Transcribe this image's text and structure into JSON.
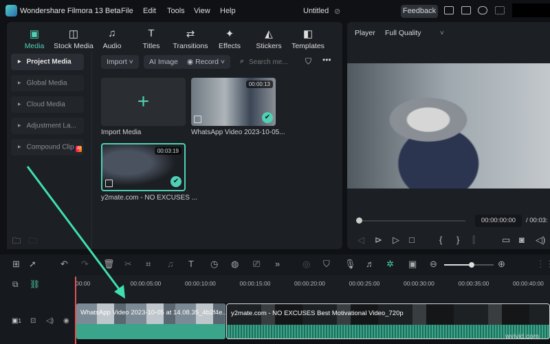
{
  "app": {
    "title": "Wondershare Filmora 13 Beta",
    "project": "Untitled",
    "menu": [
      "File",
      "Edit",
      "Tools",
      "View",
      "Help"
    ],
    "feedback": "Feedback"
  },
  "tabs": [
    {
      "label": "Media",
      "icon": "media-icon",
      "glyph": "▣"
    },
    {
      "label": "Stock Media",
      "icon": "stock-media-icon",
      "glyph": "◫"
    },
    {
      "label": "Audio",
      "icon": "music-note-icon",
      "glyph": "♫"
    },
    {
      "label": "Titles",
      "icon": "text-icon",
      "glyph": "T"
    },
    {
      "label": "Transitions",
      "icon": "transitions-icon",
      "glyph": "⇄"
    },
    {
      "label": "Effects",
      "icon": "effects-icon",
      "glyph": "✦"
    },
    {
      "label": "Stickers",
      "icon": "stickers-icon",
      "glyph": "◭"
    },
    {
      "label": "Templates",
      "icon": "templates-icon",
      "glyph": "◧"
    }
  ],
  "sidebar": {
    "items": [
      {
        "label": "Project Media"
      },
      {
        "label": "Global Media"
      },
      {
        "label": "Cloud Media"
      },
      {
        "label": "Adjustment La..."
      },
      {
        "label": "Compound Clip",
        "badge": "AI"
      }
    ]
  },
  "toolbar": {
    "import": "Import",
    "ai_image": "AI Image",
    "record": "Record",
    "search_placeholder": "Search me..."
  },
  "media": [
    {
      "label": "Import Media"
    },
    {
      "label": "WhatsApp Video 2023-10-05...",
      "duration": "00:00:13"
    },
    {
      "label": "y2mate.com - NO EXCUSES ...",
      "duration": "00:03:19"
    }
  ],
  "player": {
    "label": "Player",
    "quality": "Full Quality",
    "current": "00:00:00:00",
    "total": "/ 00:03:"
  },
  "timeline": {
    "ruler": [
      "00:00",
      "00:00:05:00",
      "00:00:10:00",
      "00:00:15:00",
      "00:00:20:00",
      "00:00:25:00",
      "00:00:30:00",
      "00:00:35:00",
      "00:00:40:00"
    ],
    "track_number": "1",
    "clips": [
      {
        "title": "WhatsApp Video 2023-10-05 at 14.08.35_4b2f4e..."
      },
      {
        "title": "y2mate.com - NO EXCUSES  Best Motivational Video_720p"
      }
    ],
    "zoom_level": 0.55
  },
  "watermark": "wvivid.com",
  "colors": {
    "accent": "#4fd1b5",
    "playhead": "#e05555"
  }
}
